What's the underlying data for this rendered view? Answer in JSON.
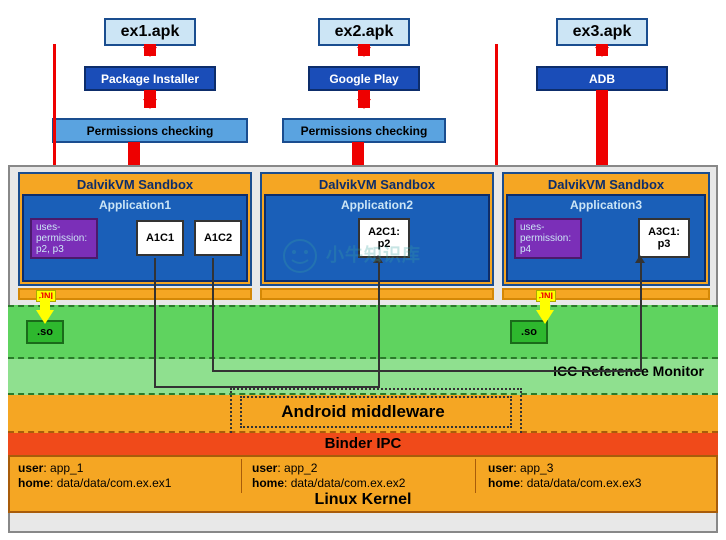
{
  "apk": {
    "ex1": "ex1.apk",
    "ex2": "ex2.apk",
    "ex3": "ex3.apk"
  },
  "installers": {
    "pkg": "Package Installer",
    "play": "Google Play",
    "adb": "ADB"
  },
  "permcheck": {
    "c1": "Permissions checking",
    "c2": "Permissions checking"
  },
  "sandbox_title": "DalvikVM    Sandbox",
  "apps": {
    "a1": {
      "title": "Application1",
      "perm": "uses-permission:\np2, p3",
      "c1": "A1C1",
      "c2": "A1C2"
    },
    "a2": {
      "title": "Application2",
      "c1": "A2C1:\np2"
    },
    "a3": {
      "title": "Application3",
      "perm": "uses-permission:\np4",
      "c1": "A3C1:\np3"
    }
  },
  "jni": "JNI",
  "so": ".so",
  "icc": "ICC Reference Monitor",
  "middleware": "Android middleware",
  "binder": "Binder IPC",
  "kernel": {
    "label": "Linux Kernel",
    "u1": {
      "user": "user",
      "uval": "app_1",
      "home": "home",
      "hval": "data/data/com.ex.ex1"
    },
    "u2": {
      "user": "user",
      "uval": "app_2",
      "home": "home",
      "hval": "data/data/com.ex.ex2"
    },
    "u3": {
      "user": "user",
      "uval": "app_3",
      "home": "home",
      "hval": "data/data/com.ex.ex3"
    }
  },
  "watermark": "小牛知识库"
}
